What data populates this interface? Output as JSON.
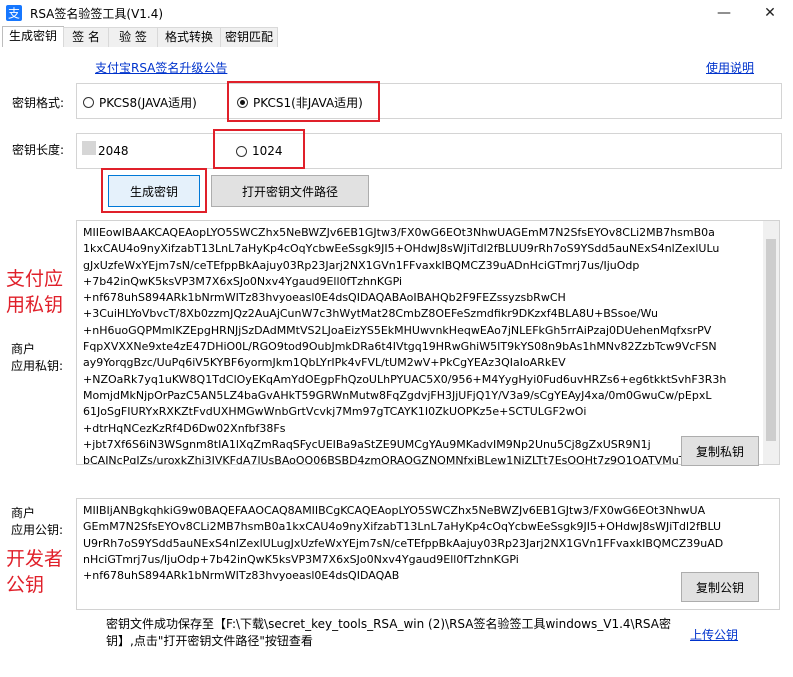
{
  "window": {
    "title": "RSA签名验签工具(V1.4)",
    "minimize": "—",
    "close": "✕"
  },
  "tabs": [
    {
      "label": "生成密钥"
    },
    {
      "label": "签 名"
    },
    {
      "label": "验 签"
    },
    {
      "label": "格式转换"
    },
    {
      "label": "密钥匹配"
    }
  ],
  "links": {
    "notice": "支付宝RSA签名升级公告",
    "help": "使用说明",
    "upload": "上传公钥"
  },
  "key_format": {
    "label": "密钥格式:",
    "options": [
      "PKCS8(JAVA适用)",
      "PKCS1(非JAVA适用)"
    ],
    "selected": "PKCS1(非JAVA适用)"
  },
  "key_length": {
    "label": "密钥长度:",
    "options": [
      "2048",
      "1024"
    ],
    "selected": "none"
  },
  "buttons": {
    "generate": "生成密钥",
    "open_path": "打开密钥文件路径",
    "copy_private": "复制私钥",
    "copy_public": "复制公钥"
  },
  "private_key": {
    "label_line1": "商户",
    "label_line2": "应用私钥:",
    "lines": [
      "MIIEowIBAAKCAQEAopLYO5SWCZhx5NeBWZJv6EB1GJtw3/FX0wG6EOt3NhwUAGEmM7N2SfsEYOv8CLi2MB7hsmB0a",
      "1kxCAU4o9nyXifzabT13LnL7aHyKp4cOqYcbwEeSsgk9JI5+OHdwJ8sWJiTdl2fBLUU9rRh7oS9YSdd5auNExS4nlZexlULu",
      "gJxUzfeWxYEjm7sN/ceTEfppBkAajuy03Rp23Jarj2NX1GVn1FFvaxkIBQMCZ39uADnHciGTmrj7us/IjuOdp",
      "+7b42inQwK5ksVP3M7X6xSJo0Nxv4Ygaud9Ell0fTzhnKGPi",
      "+nf678uhS894ARk1bNrmWITz83hvyoeasl0E4dsQIDAQABAoIBAHQb2F9FEZssyzsbRwCH",
      "+3CuiHLYoVbvcT/8Xb0zzmJQz2AuAjCunW7c3hWytMat28CmbZ8OEFeSzmdfikr9DKzxf4BLA8U+BSsoe/Wu",
      "+nH6uoGQPMmlKZEpgHRNJjSzDAdMMtVS2LJoaEizYS5EkMHUwvnkHeqwEAo7jNLEFkGh5rrAiPzaj0DUehenMqfxsrPV",
      "FqpXVXXNe9xte4zE47DHiO0L/RGO9tod9OubJmkDRa6t4IVtgq19HRwGhiW5IT9kYS08n9bAs1hMNv82ZzbTcw9VcFSN",
      "ay9YorqgBzc/UuPq6iV5KYBF6yormJkm1QbLYrIPk4vFVL/tUM2wV+PkCgYEAz3QIaIoARkEV",
      "+NZOaRk7yq1uKW8Q1TdClOyEKqAmYdOEgpFhQzoULhPYUAC5X0/956+M4YygHyi0Fud6uvHRZs6+eg6tkktSvhF3R3h",
      "MomjdMkNjpOrPazC5AN5LZ4baGvAHkT59GRWnMutw8FqZgdvjFH3JjUFjQ1Y/V3a9/sCgYEAyJ4xa/0m0GwuCw/pEpxL",
      "61JoSgFIURYxRXKZtFvdUXHMGwWnbGrtVcvkj7Mm97gTCAYK1I0ZkUOPKz5e+SCTULGF2wOi",
      "+dtrHqNCezKzRf4D6Dw02Xnfbf38Fs",
      "+jbt7Xf6S6iN3WSgnm8tIA1lXqZmRaqSFycUEIBa9aStZE9UMCgYAu9MKadvIM9Np2Unu5Cj8gZxUSR9N1j",
      "bCAINcPgJZs/uroxkZhj3IVKFdA7lUsBAoOQ06BSBD4zmQRAOGZNQMNfxjBLew1NjZLTt7EsOQHt7z9Q1QATVMuTTYM"
    ]
  },
  "public_key": {
    "label_line1": "商户",
    "label_line2": "应用公钥:",
    "lines": [
      "MIIBIjANBgkqhkiG9w0BAQEFAAOCAQ8AMIIBCgKCAQEAopLYO5SWCZhx5NeBWZJv6EB1GJtw3/FX0wG6EOt3NhwUA",
      "GEmM7N2SfsEYOv8CLi2MB7hsmB0a1kxCAU4o9nyXifzabT13LnL7aHyKp4cOqYcbwEeSsgk9JI5+OHdwJ8sWJiTdl2fBLU",
      "U9rRh7oS9YSdd5auNExS4nlZexlULugJxUzfeWxYEjm7sN/ceTEfppBkAajuy03Rp23Jarj2NX1GVn1FFvaxkIBQMCZ39uAD",
      "nHciGTmrj7us/IjuOdp+7b42inQwK5ksVP3M7X6xSJo0Nxv4Ygaud9Ell0fTzhnKGPi",
      "+nf678uhS894ARk1bNrmWITz83hvyoeasl0E4dsQIDAQAB"
    ]
  },
  "status": {
    "line1": "密钥文件成功保存至【F:\\下载\\secret_key_tools_RSA_win (2)\\RSA签名验签工具windows_V1.4\\RSA密",
    "line2": "钥】,点击\"打开密钥文件路径\"按钮查看"
  },
  "annotations": {
    "private": [
      "支付应",
      "用私钥"
    ],
    "public": [
      "开发者",
      "公钥"
    ]
  },
  "colors": {
    "accent_red": "#e0202a",
    "link_blue": "#0033cc",
    "app_icon_blue": "#1677ff"
  }
}
